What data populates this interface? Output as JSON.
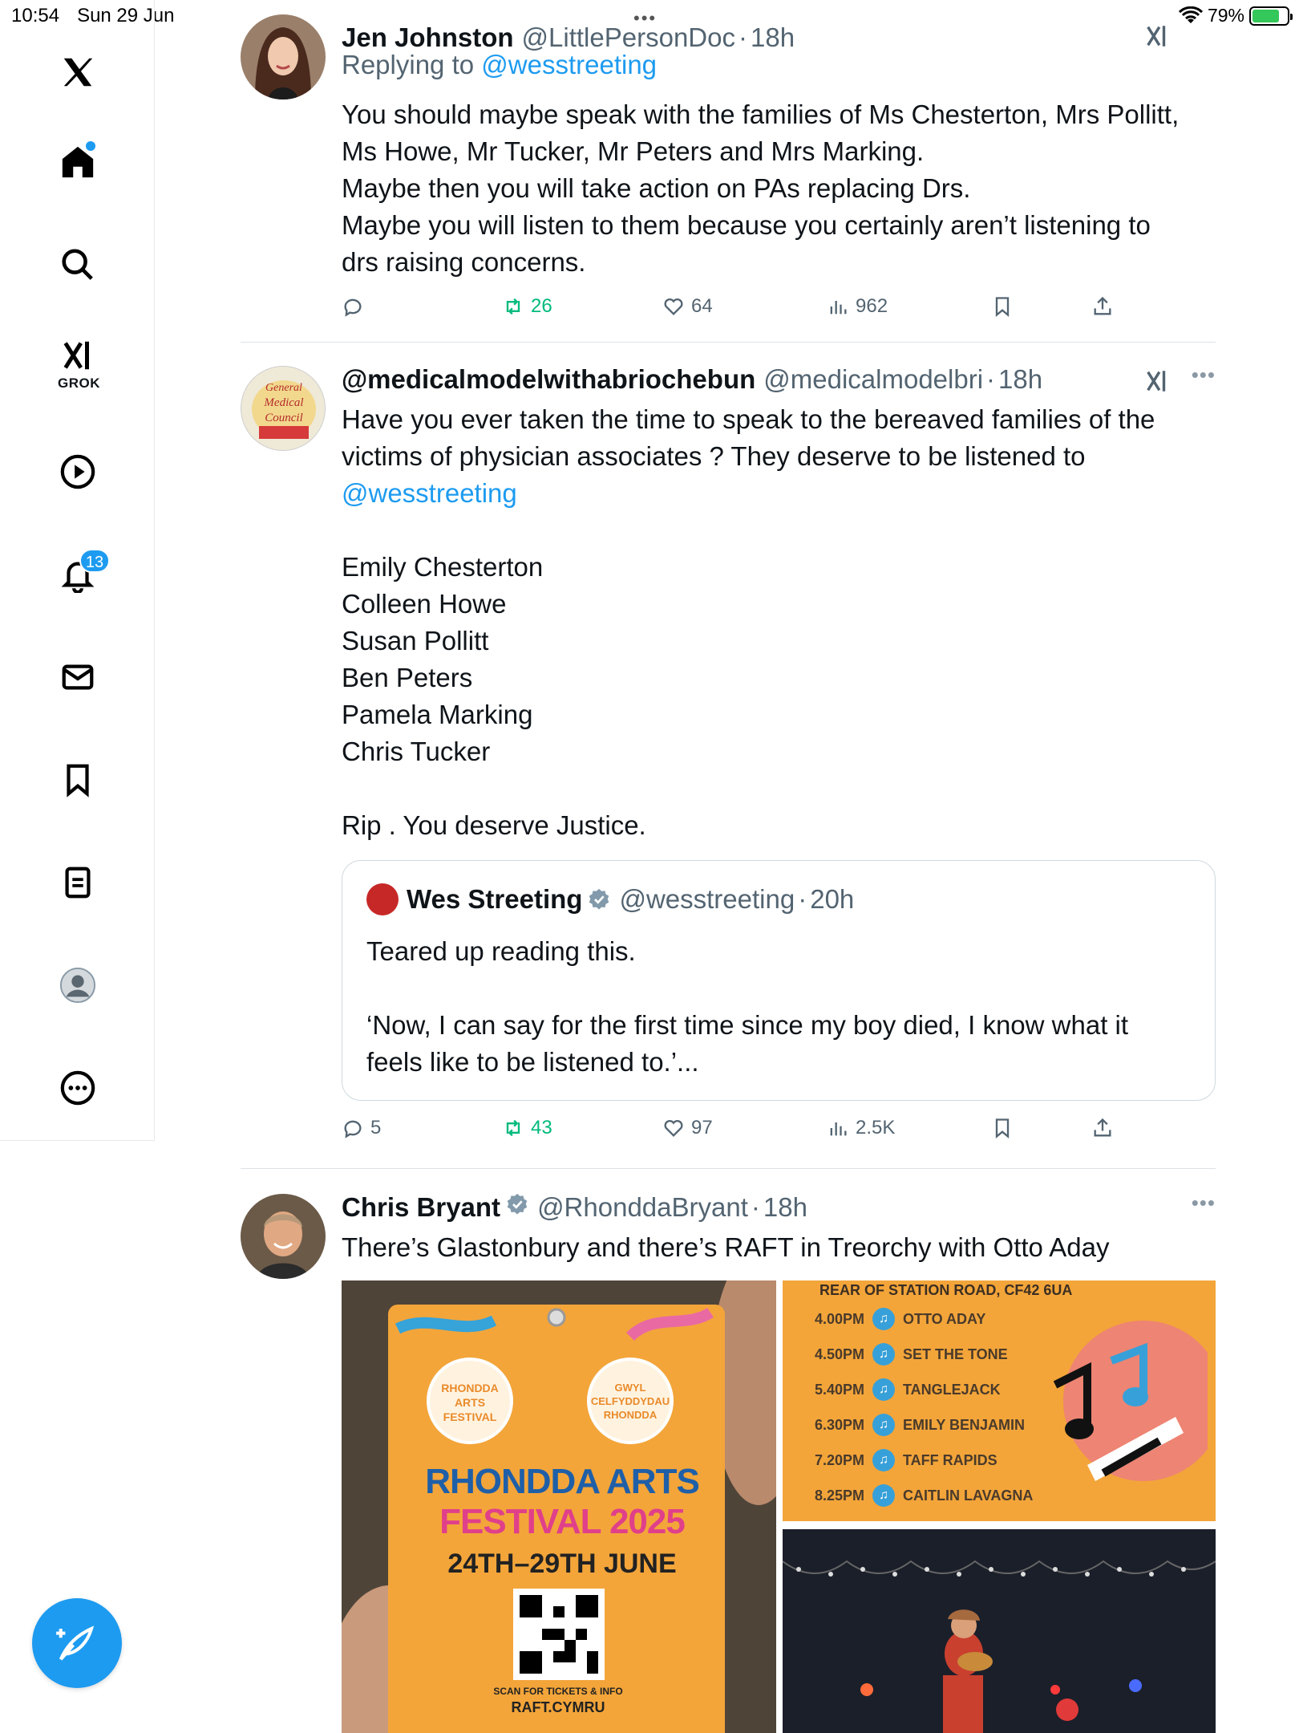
{
  "status_bar": {
    "time": "10:54",
    "date": "Sun 29 Jun",
    "battery": "79%",
    "battery_level": 0.79
  },
  "sidebar": {
    "items": [
      {
        "name": "X",
        "icon": "x-logo-icon"
      },
      {
        "name": "Home",
        "icon": "home-icon"
      },
      {
        "name": "Explore",
        "icon": "search-icon"
      },
      {
        "name": "Grok",
        "icon": "grok-icon",
        "label": "GROK"
      },
      {
        "name": "Videos",
        "icon": "play-icon"
      },
      {
        "name": "Notifications",
        "icon": "bell-icon",
        "badge": "13"
      },
      {
        "name": "Messages",
        "icon": "mail-icon"
      },
      {
        "name": "Bookmarks",
        "icon": "bookmark-icon"
      },
      {
        "name": "Articles",
        "icon": "article-icon"
      },
      {
        "name": "Profile",
        "icon": "avatar-icon"
      },
      {
        "name": "More",
        "icon": "more-icon"
      }
    ],
    "compose_icon": "compose-icon"
  },
  "tweets": [
    {
      "name": "Jen Johnston",
      "handle": "@LittlePersonDoc",
      "time": "18h",
      "replying_prefix": "Replying to ",
      "replying_to": "@wesstreeting",
      "text": [
        "You should maybe speak with the families of Ms Chesterton, Mrs Pollitt,",
        "Ms Howe, Mr Tucker, Mr Peters and Mrs Marking.",
        "Maybe then you will take action on PAs replacing Drs.",
        "Maybe you will listen to them because you certainly aren’t listening to",
        "drs raising concerns."
      ],
      "replies": "",
      "retweets": "26",
      "likes": "64",
      "views": "962"
    },
    {
      "name": "@medicalmodelwithabriochebun",
      "handle": "@medicalmodelbri",
      "time": "18h",
      "text": [
        "Have you ever taken the time to speak to the bereaved families of the",
        "victims of physician associates ? They deserve to be listened to",
        "",
        "",
        "Emily Chesterton",
        "Colleen Howe",
        "Susan Pollitt",
        "Ben Peters",
        "Pamela Marking",
        "Chris Tucker",
        "",
        "Rip . You deserve Justice."
      ],
      "mention": "@wesstreeting",
      "avatar_text": [
        "General",
        "Medical",
        "Council"
      ],
      "quote": {
        "name": "Wes Streeting",
        "handle": "@wesstreeting",
        "time": "20h",
        "text": [
          "Teared up reading this.",
          "",
          "‘Now, I can say for the first time since my boy died, I know what it",
          "feels like to be listened to.’..."
        ]
      },
      "replies": "5",
      "retweets": "43",
      "likes": "97",
      "views": "2.5K"
    },
    {
      "name": "Chris Bryant",
      "handle": "@RhonddaBryant",
      "time": "18h",
      "text": [
        "There’s Glastonbury and there’s RAFT in Treorchy with Otto Aday"
      ],
      "media": {
        "lanyard": {
          "title_line1": "RHONDDA ARTS",
          "title_line2": "FESTIVAL 2025",
          "dates": "24TH–29TH JUNE",
          "badge_left": "RHONDDA ARTS FESTIVAL",
          "badge_right": "GWYL CELFYDDYDAU RHONDDA",
          "footer": "SCAN FOR TICKETS & INFO",
          "url": "RAFT.CYMRU"
        },
        "schedule": {
          "address": "REAR OF STATION ROAD, CF42 6UA",
          "rows": [
            {
              "time": "4.00PM",
              "act": "OTTO ADAY"
            },
            {
              "time": "4.50PM",
              "act": "SET THE TONE"
            },
            {
              "time": "5.40PM",
              "act": "TANGLEJACK"
            },
            {
              "time": "6.30PM",
              "act": "EMILY BENJAMIN"
            },
            {
              "time": "7.20PM",
              "act": "TAFF RAPIDS"
            },
            {
              "time": "8.25PM",
              "act": "CAITLIN LAVAGNA"
            }
          ]
        }
      }
    }
  ],
  "colors": {
    "accent": "#1d9bf0",
    "retweet": "#00ba7c",
    "muted": "#536471",
    "festival_orange": "#f3a53a"
  }
}
